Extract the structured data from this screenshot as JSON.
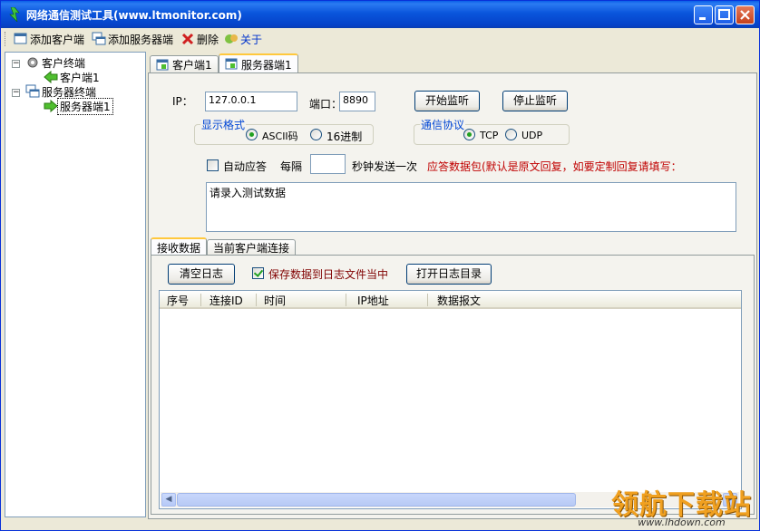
{
  "window": {
    "title": "网络通信测试工具(www.ltmonitor.com)"
  },
  "toolbar": {
    "add_client": "添加客户端",
    "add_server": "添加服务器端",
    "delete": "删除",
    "about": "关于"
  },
  "tree": {
    "client_root": "客户终端",
    "client_child": "客户端1",
    "server_root": "服务器终端",
    "server_child": "服务器端1"
  },
  "tabs": {
    "client_tab": "客户端1",
    "server_tab": "服务器端1"
  },
  "server": {
    "ip_label": "IP：",
    "ip_value": "127.0.0.1",
    "port_label": "端口：",
    "port_value": "8890",
    "start_btn": "开始监听",
    "stop_btn": "停止监听",
    "format_group": "显示格式",
    "format_ascii": "ASCII码",
    "format_hex": "16进制",
    "protocol_group": "通信协议",
    "proto_tcp": "TCP",
    "proto_udp": "UDP",
    "auto_reply": "自动应答",
    "every": "每隔",
    "interval_value": "",
    "interval_suffix": "秒钟发送一次",
    "reply_hint": "应答数据包(默认是原文回复，如要定制回复请填写：",
    "test_data": "请录入测试数据"
  },
  "bottom_tabs": {
    "recv": "接收数据",
    "conn": "当前客户端连接"
  },
  "recv": {
    "clear_btn": "清空日志",
    "save_label": "保存数据到日志文件当中",
    "open_dir_btn": "打开日志目录",
    "columns": [
      "序号",
      "连接ID",
      "时间",
      "IP地址",
      "数据报文"
    ]
  },
  "watermark": {
    "main": "领航下载站",
    "sub": "www.lhdown.com"
  },
  "colors": {
    "title_blue": "#0a55dc",
    "group_title": "#0046d5",
    "hint_red": "#c00000"
  }
}
